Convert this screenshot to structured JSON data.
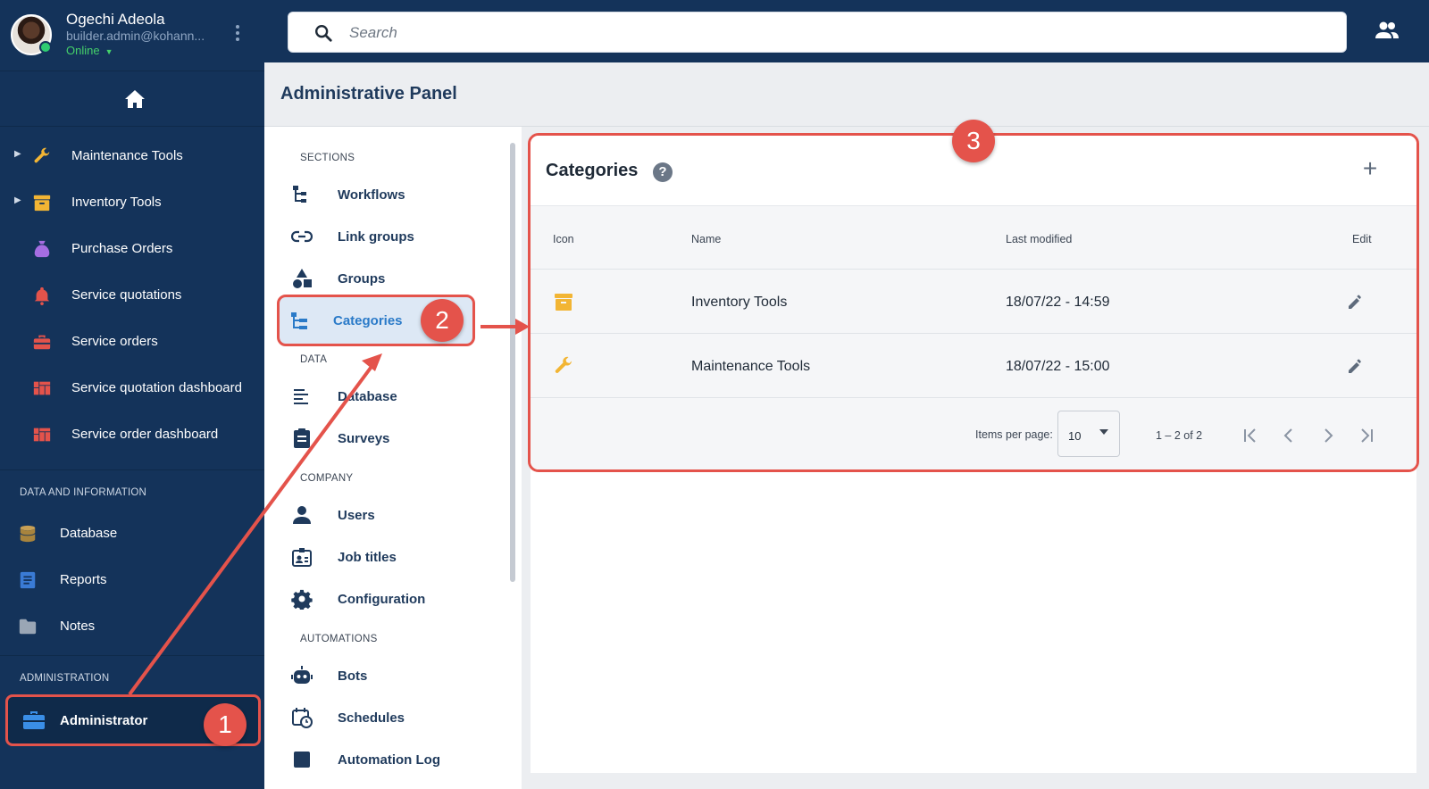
{
  "user": {
    "name": "Ogechi Adeola",
    "email": "builder.admin@kohann...",
    "status": "Online"
  },
  "search": {
    "placeholder": "Search"
  },
  "sidebar": {
    "items": [
      {
        "label": "Maintenance Tools",
        "icon": "wrench-icon"
      },
      {
        "label": "Inventory Tools",
        "icon": "archive-box-icon"
      },
      {
        "label": "Purchase Orders",
        "icon": "money-bag-icon"
      },
      {
        "label": "Service quotations",
        "icon": "bell-icon"
      },
      {
        "label": "Service orders",
        "icon": "toolbox-icon"
      },
      {
        "label": "Service quotation dashboard",
        "icon": "dashboard-icon"
      },
      {
        "label": "Service order dashboard",
        "icon": "dashboard-icon"
      }
    ],
    "data_section_heading": "DATA AND INFORMATION",
    "data_items": [
      {
        "label": "Database",
        "icon": "database-icon"
      },
      {
        "label": "Reports",
        "icon": "document-icon"
      },
      {
        "label": "Notes",
        "icon": "folder-icon"
      }
    ],
    "admin_section_heading": "ADMINISTRATION",
    "admin_item": {
      "label": "Administrator",
      "icon": "toolbox-icon"
    }
  },
  "panel": {
    "title": "Administrative Panel"
  },
  "sections_menu": {
    "headings": {
      "sections": "SECTIONS",
      "data": "DATA",
      "company": "COMPANY",
      "automations": "AUTOMATIONS"
    },
    "items": {
      "workflows": "Workflows",
      "link_groups": "Link groups",
      "groups": "Groups",
      "categories": "Categories",
      "database": "Database",
      "surveys": "Surveys",
      "users": "Users",
      "job_titles": "Job titles",
      "configuration": "Configuration",
      "bots": "Bots",
      "schedules": "Schedules",
      "automation_log": "Automation Log"
    },
    "selected": "Categories"
  },
  "categories_card": {
    "title": "Categories",
    "columns": {
      "icon": "Icon",
      "name": "Name",
      "last_modified": "Last modified",
      "edit": "Edit"
    },
    "rows": [
      {
        "icon": "archive-box-icon",
        "name": "Inventory Tools",
        "last_modified": "18/07/22 - 14:59"
      },
      {
        "icon": "wrench-icon",
        "name": "Maintenance Tools",
        "last_modified": "18/07/22 - 15:00"
      }
    ],
    "pager": {
      "items_per_page_label": "Items per page:",
      "items_per_page": "10",
      "range": "1 – 2 of 2"
    }
  },
  "annotations": {
    "step1": "1",
    "step2": "2",
    "step3": "3"
  },
  "colors": {
    "sidebar_bg": "#14335a",
    "accent_red": "#e4534b",
    "selected_blue": "#2a7ac8",
    "online_green": "#45d16a",
    "icon_yellow": "#f2b534"
  }
}
